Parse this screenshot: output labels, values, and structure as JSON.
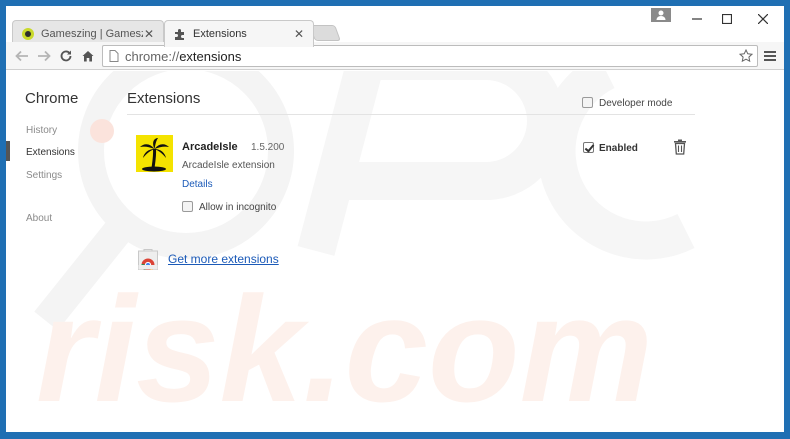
{
  "tabs": [
    {
      "title": "Gameszing | Gameszing G",
      "active": false
    },
    {
      "title": "Extensions",
      "active": true
    }
  ],
  "address": {
    "scheme": "chrome://",
    "host": "extensions"
  },
  "sidebar": {
    "title": "Chrome",
    "items": [
      {
        "label": "History",
        "selected": false
      },
      {
        "label": "Extensions",
        "selected": true
      },
      {
        "label": "Settings",
        "selected": false
      },
      {
        "label": "About",
        "selected": false
      }
    ]
  },
  "main": {
    "title": "Extensions",
    "developer_mode_label": "Developer mode",
    "developer_mode_checked": false,
    "extension": {
      "name": "ArcadeIsle",
      "version": "1.5.200",
      "description": "ArcadeIsle extension",
      "details_link": "Details",
      "incognito_label": "Allow in incognito",
      "incognito_checked": false,
      "enabled_label": "Enabled",
      "enabled_checked": true
    },
    "get_more_link": "Get more extensions"
  },
  "colors": {
    "link": "#1b5ab8",
    "ext_icon_bg": "#f4e300",
    "frame": "#1f6fb3"
  }
}
